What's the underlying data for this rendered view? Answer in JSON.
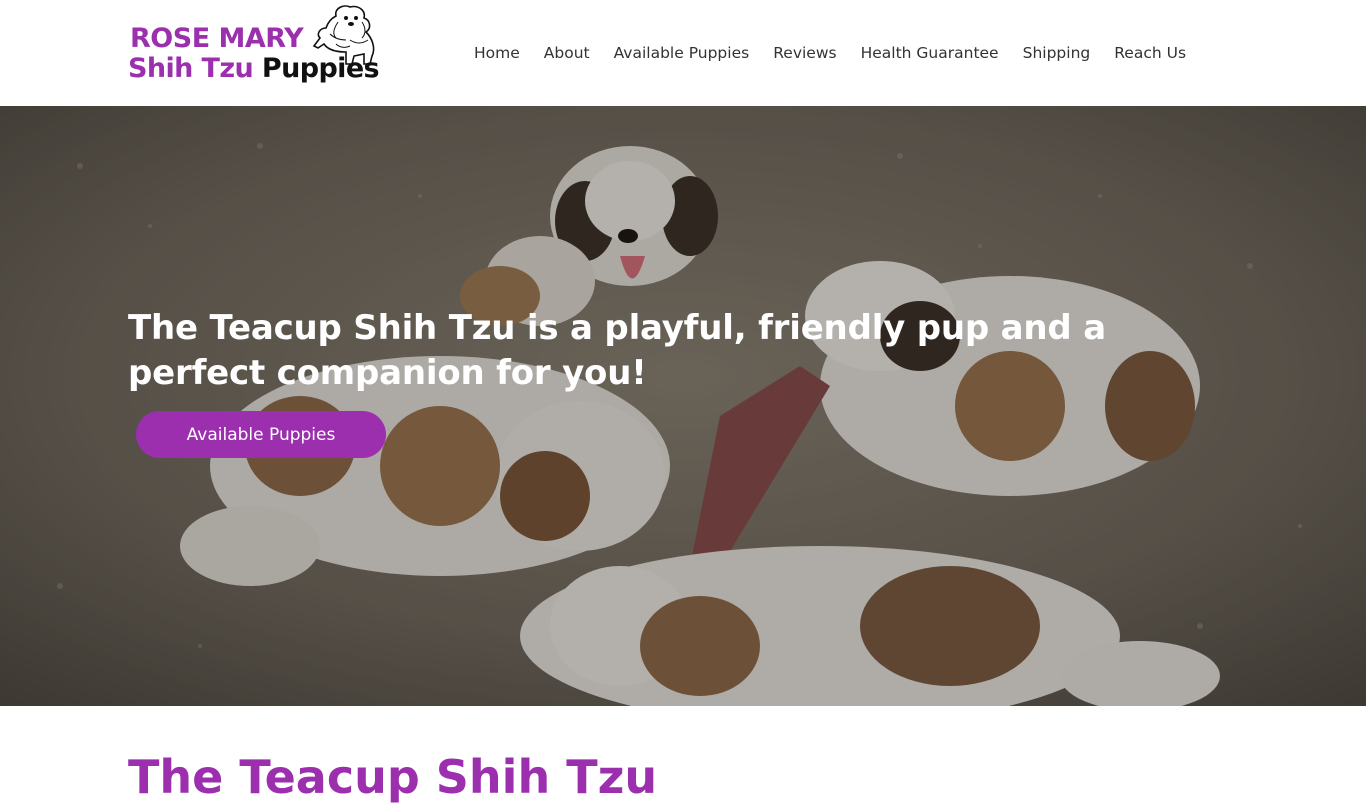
{
  "brand": {
    "line1": "ROSE MARY",
    "line2_purple": "Shih Tzu",
    "line2_black": "Puppies",
    "color_purple": "#9b2fae"
  },
  "nav": {
    "items": [
      {
        "label": "Home"
      },
      {
        "label": "About"
      },
      {
        "label": "Available Puppies"
      },
      {
        "label": "Reviews"
      },
      {
        "label": "Health Guarantee"
      },
      {
        "label": "Shipping"
      },
      {
        "label": "Reach Us"
      }
    ]
  },
  "hero": {
    "title": "The Teacup Shih Tzu is a playful, friendly pup and a perfect companion for you!",
    "button_label": "Available Puppies",
    "image": "photo of Shih Tzu puppies playing on gravel"
  },
  "section": {
    "heading": "The Teacup Shih Tzu"
  }
}
